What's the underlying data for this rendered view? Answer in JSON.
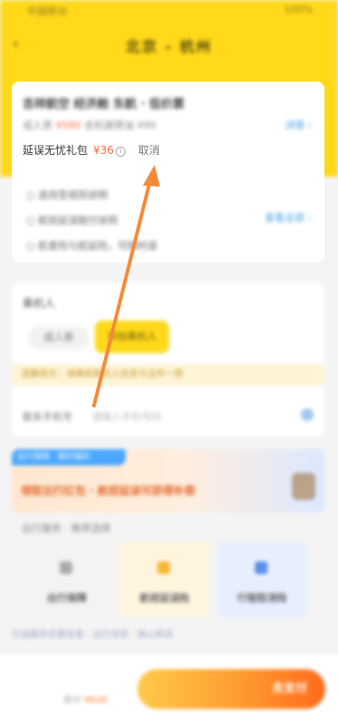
{
  "status": {
    "time": "中国移动",
    "battery": "100%"
  },
  "nav": {
    "back": "‹",
    "title": "北京 - 杭州"
  },
  "flight": {
    "name": "吉祥航空 经济舱 东航 · 低价票",
    "price_line_prefix": "成人票",
    "price_line_orange": "¥590",
    "price_line_suffix": " 含机建燃油 ¥90",
    "detail_link": "详情 ›"
  },
  "delay_gift": {
    "label": "延误无忧礼包",
    "price": "¥36",
    "info": "i",
    "cancel": "取消"
  },
  "bullets": [
    "退改签规则说明",
    "航班延误赔付说明",
    "航意险与航延险，可随时退"
  ],
  "more_link": "查看全部 ›",
  "passenger": {
    "title": "乘机人",
    "tab_a": "成人票",
    "tab_b": "添加乘机人",
    "notice": "温馨提示：请确保乘机人信息与证件一致",
    "field_label": "联系手机号",
    "field_placeholder": "请输入手机号码"
  },
  "banner": {
    "tag": "出行保障 · 限时福利",
    "text": "领取出行红包 · 航班延误可获得补偿"
  },
  "services": {
    "title": "出行服务 · 推荐选择",
    "items": [
      "出行保障",
      "航班延误险",
      "行程取消险"
    ]
  },
  "promo_text": "已选服务优惠信息 · 出行无忧 · 放心购买",
  "bottom": {
    "total_label": "合计",
    "total_price": "¥626",
    "pay_label": "去支付"
  },
  "colors": {
    "brand_yellow": "#ffd91a",
    "accent_orange": "#ff6a3d",
    "link_blue": "#4aa3e0",
    "arrow_orange": "#f58a3a"
  }
}
